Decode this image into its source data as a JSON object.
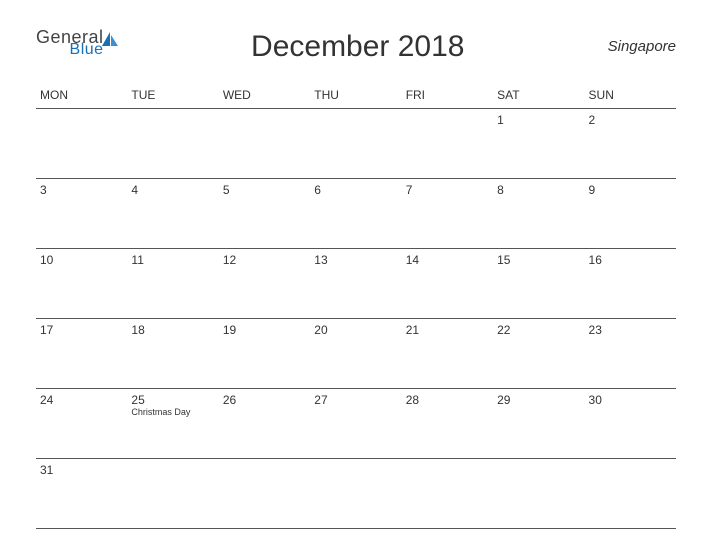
{
  "logo": {
    "line1": "General",
    "line2": "Blue"
  },
  "title": "December 2018",
  "region": "Singapore",
  "dow": [
    "MON",
    "TUE",
    "WED",
    "THU",
    "FRI",
    "SAT",
    "SUN"
  ],
  "weeks": [
    [
      {
        "n": ""
      },
      {
        "n": ""
      },
      {
        "n": ""
      },
      {
        "n": ""
      },
      {
        "n": ""
      },
      {
        "n": "1"
      },
      {
        "n": "2"
      }
    ],
    [
      {
        "n": "3"
      },
      {
        "n": "4"
      },
      {
        "n": "5"
      },
      {
        "n": "6"
      },
      {
        "n": "7"
      },
      {
        "n": "8"
      },
      {
        "n": "9"
      }
    ],
    [
      {
        "n": "10"
      },
      {
        "n": "11"
      },
      {
        "n": "12"
      },
      {
        "n": "13"
      },
      {
        "n": "14"
      },
      {
        "n": "15"
      },
      {
        "n": "16"
      }
    ],
    [
      {
        "n": "17"
      },
      {
        "n": "18"
      },
      {
        "n": "19"
      },
      {
        "n": "20"
      },
      {
        "n": "21"
      },
      {
        "n": "22"
      },
      {
        "n": "23"
      }
    ],
    [
      {
        "n": "24"
      },
      {
        "n": "25",
        "e": "Christmas Day"
      },
      {
        "n": "26"
      },
      {
        "n": "27"
      },
      {
        "n": "28"
      },
      {
        "n": "29"
      },
      {
        "n": "30"
      }
    ],
    [
      {
        "n": "31"
      },
      {
        "n": ""
      },
      {
        "n": ""
      },
      {
        "n": ""
      },
      {
        "n": ""
      },
      {
        "n": ""
      },
      {
        "n": ""
      }
    ]
  ]
}
